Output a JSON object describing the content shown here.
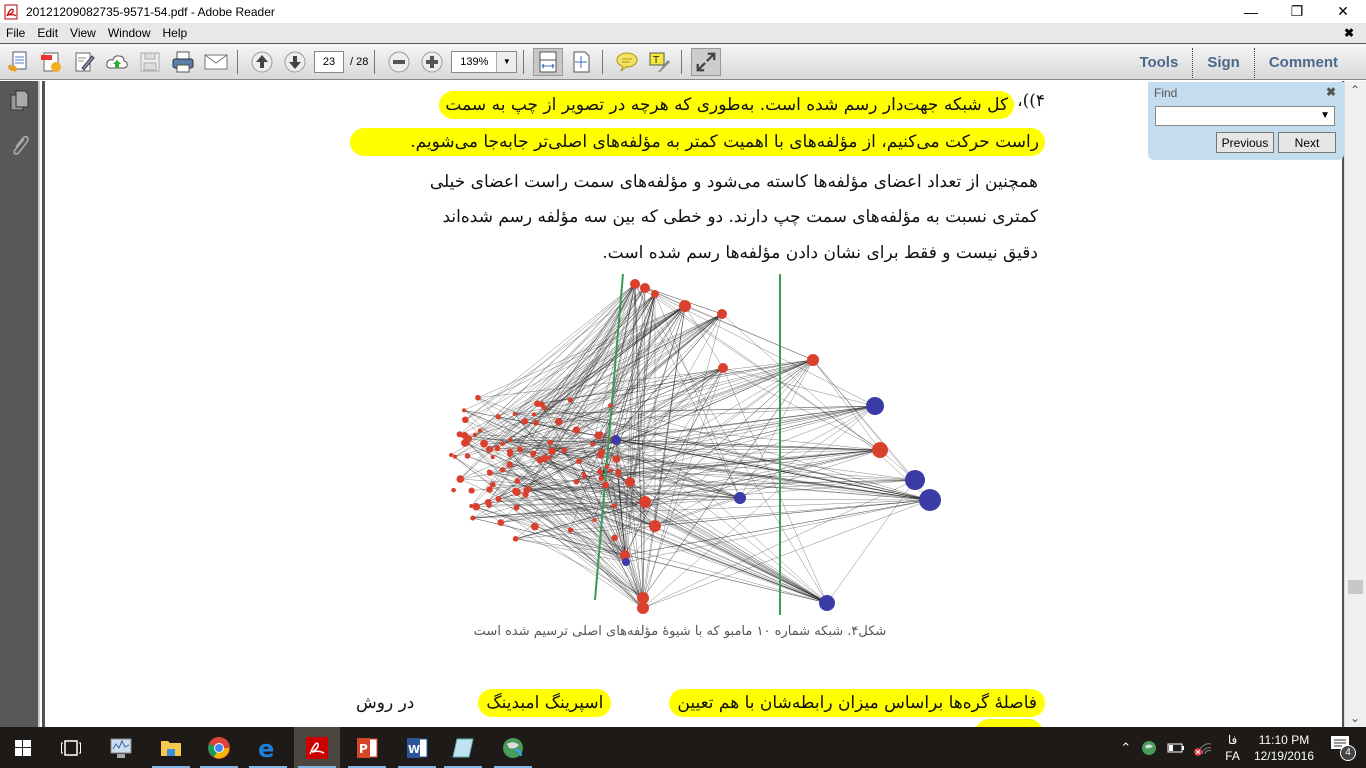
{
  "window": {
    "title": "20121209082735-9571-54.pdf - Adobe Reader",
    "minimize": "—",
    "maximize": "❐",
    "close": "✕"
  },
  "menu": {
    "items": [
      "File",
      "Edit",
      "View",
      "Window",
      "Help"
    ],
    "close_doc": "✖"
  },
  "toolbar": {
    "page_current": "23",
    "page_total": "/ 28",
    "zoom_value": "139%",
    "tools_label": "Tools",
    "sign_label": "Sign",
    "comment_label": "Comment"
  },
  "find": {
    "label": "Find",
    "close": "✖",
    "query": "",
    "previous_label": "Previous",
    "next_label": "Next"
  },
  "document": {
    "para1_line1_prefix": "۴))،",
    "para1_line1": "کل شبکه جهت‌دار رسم شده است. به‌طوری که هرچه در تصویر از چپ به سمت",
    "para1_line2": "راست حرکت می‌کنیم، از مؤلفه‌های با اهمیت کمتر به مؤلفه‌های اصلی‌تر جابه‌جا می‌شویم.",
    "para1_line3": "همچنین از تعداد اعضای مؤلفه‌ها کاسته می‌شود و مؤلفه‌های سمت راست اعضای خیلی",
    "para1_line4": "کمتری نسبت به مؤلفه‌های سمت چپ دارند. دو خطی که بین سه مؤلفه رسم شده‌اند",
    "para1_line5": "دقیق نیست و فقط برای نشان دادن مؤلفه‌ها رسم شده است.",
    "figure_caption": "شکل۴. شبکه شماره ۱۰ مامبو که با شیوهٔ مؤلفه‌های اصلی ترسیم شده است",
    "para2_w1": "در روش",
    "para2_w2": "اسپرینگ امبدینگ",
    "para2_w3": "فاصلهٔ گره‌ها براساس میزان رابطه‌شان با هم تعیین"
  },
  "taskbar": {
    "apps": [
      "start",
      "task-view",
      "performance-monitor",
      "file-explorer",
      "chrome",
      "edge",
      "adobe-reader",
      "powerpoint",
      "word",
      "notepad",
      "vpn-globe"
    ],
    "active_app": "adobe-reader",
    "lang_top": "فا",
    "lang_bottom": "FA",
    "time": "11:10 PM",
    "date": "12/19/2016",
    "notifications": "4"
  }
}
